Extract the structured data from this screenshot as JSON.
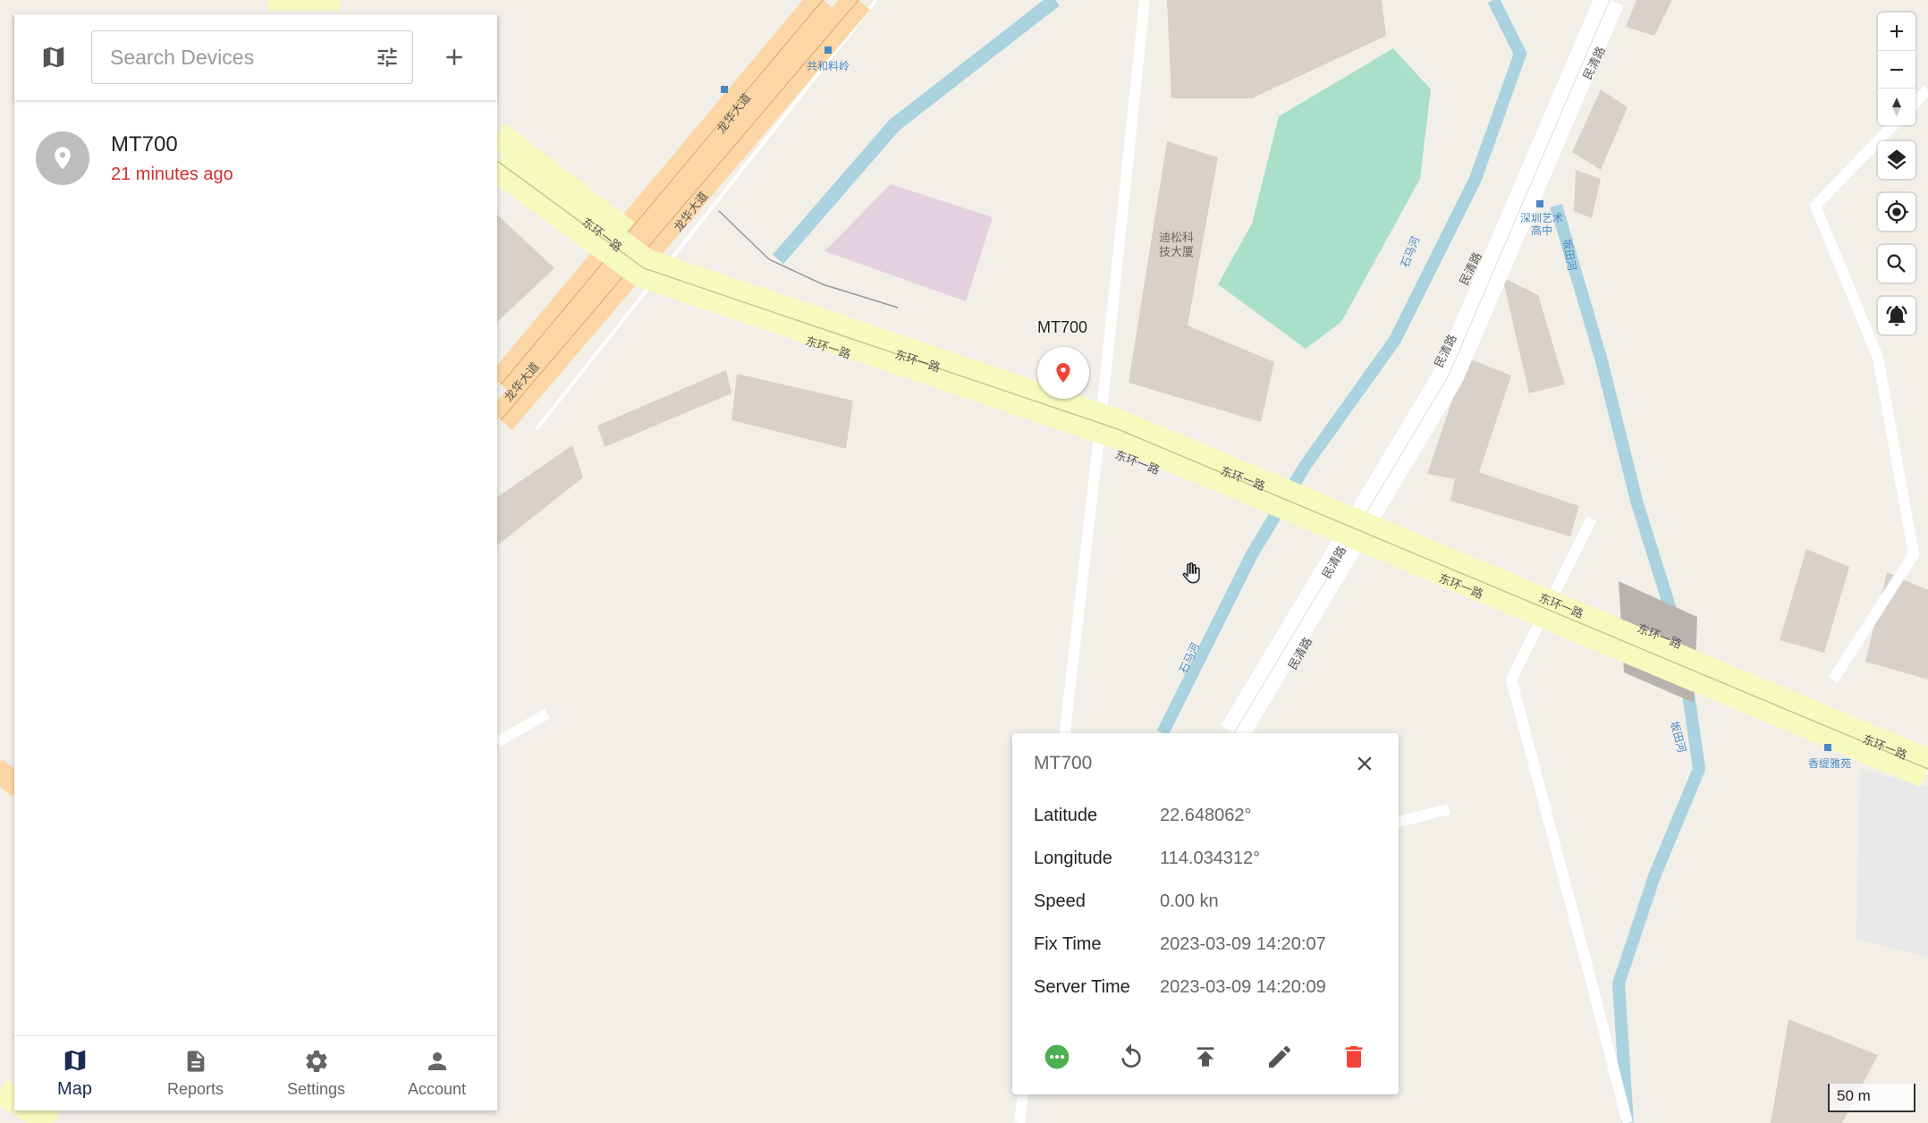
{
  "sidebar": {
    "search": {
      "placeholder": "Search Devices",
      "value": ""
    },
    "devices": [
      {
        "name": "MT700",
        "status": "21 minutes ago"
      }
    ],
    "nav": [
      {
        "label": "Map",
        "icon": "map-icon",
        "active": true
      },
      {
        "label": "Reports",
        "icon": "description-icon",
        "active": false
      },
      {
        "label": "Settings",
        "icon": "gear-icon",
        "active": false
      },
      {
        "label": "Account",
        "icon": "person-icon",
        "active": false
      }
    ]
  },
  "map": {
    "marker_label": "MT700",
    "scale_label": "50 m",
    "road_labels": {
      "donghuan": "东环一路",
      "longhua": "龙华大道",
      "minqing": "民清路",
      "shima": "石马河",
      "guanlan": "坂田河"
    },
    "building_labels": {
      "disong_line1": "迪松科",
      "disong_line2": "技大厦"
    },
    "poi_labels": {
      "gonghe": "共和料岭",
      "art_line1": "深圳艺术",
      "art_line2": "高中",
      "xiangti": "香缇雅苑"
    }
  },
  "popup": {
    "title": "MT700",
    "rows": [
      {
        "key": "Latitude",
        "value": "22.648062°"
      },
      {
        "key": "Longitude",
        "value": "114.034312°"
      },
      {
        "key": "Speed",
        "value": "0.00 kn"
      },
      {
        "key": "Fix Time",
        "value": "2023-03-09 14:20:07"
      },
      {
        "key": "Server Time",
        "value": "2023-03-09 14:20:09"
      }
    ]
  },
  "colors": {
    "accent": "#1a2a54",
    "status_red": "#d32f2f",
    "online_green": "#4caf50",
    "delete_red": "#f44336",
    "marker_red": "#f44336"
  }
}
